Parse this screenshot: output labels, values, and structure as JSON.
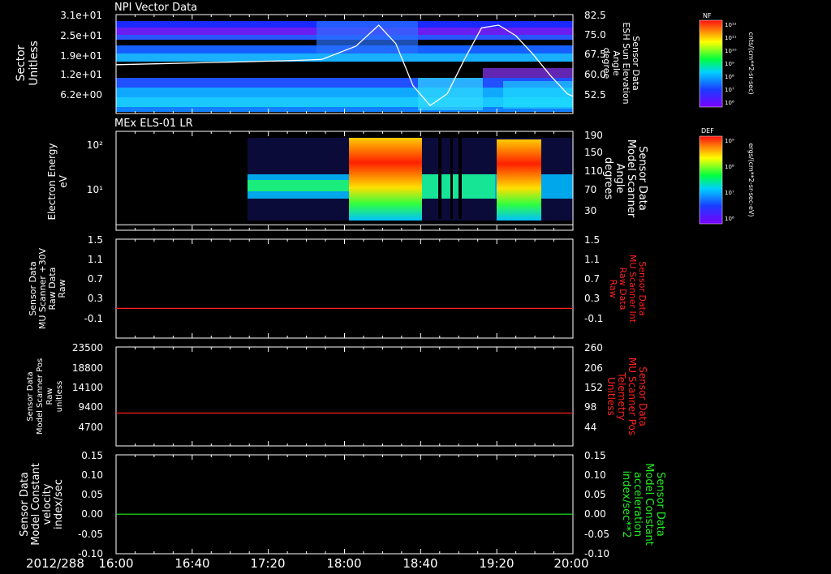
{
  "date_label": "2012/288",
  "time_axis": [
    "16:00",
    "16:40",
    "17:20",
    "18:00",
    "18:40",
    "19:20",
    "20:00"
  ],
  "colors": {
    "frame": "#ffffff",
    "red_trace": "#ff2020",
    "green_trace": "#22ee22",
    "white_trace": "#ffffff"
  },
  "chart_data": [
    {
      "id": "panel1",
      "type": "heatmap",
      "title": "NPI Vector Data",
      "ylabel_lines": [
        "Sector",
        "Unitless"
      ],
      "y_ticks": [
        "3.1e+01",
        "2.5e+01",
        "1.9e+01",
        "1.2e+01",
        "6.2e+00"
      ],
      "ylim": [
        0,
        31
      ],
      "y2label_lines": [
        "Sensor Data",
        "ESH Sun Elevation",
        "Angle",
        "degree"
      ],
      "y2_ticks": [
        "82.5",
        "75.0",
        "67.5",
        "60.0",
        "52.5"
      ],
      "y2lim": [
        47.5,
        85.0
      ],
      "colorbar": {
        "label": "NF",
        "units": "cnts/(cm**2-sr-sec)",
        "ticks": [
          "10¹²",
          "10¹¹",
          "10¹⁰",
          "10⁹",
          "10⁸",
          "10⁷",
          "10⁶"
        ]
      },
      "line_series": {
        "times": [
          16.0,
          16.5,
          17.0,
          17.5,
          17.8,
          18.1,
          18.3,
          18.45,
          18.6,
          18.75,
          18.9,
          19.05,
          19.2,
          19.35,
          19.5,
          19.65,
          19.8,
          19.95,
          20.0
        ],
        "values": [
          66,
          66.5,
          67,
          67.5,
          68,
          73,
          81,
          74,
          58,
          50.5,
          55,
          68,
          80,
          81,
          77,
          70,
          62,
          55,
          54
        ]
      }
    },
    {
      "id": "panel2",
      "type": "heatmap",
      "title": "MEx ELS-01 LR",
      "ylabel_lines": [
        "Electron Energy",
        "eV"
      ],
      "y_ticks": [
        "10²",
        "10¹"
      ],
      "y2label_lines": [
        "Sensor Data",
        "Model Scanner",
        "Angle",
        "degrees"
      ],
      "y2_ticks": [
        "190",
        "150",
        "110",
        "70",
        "30"
      ],
      "y2lim": [
        10,
        190
      ],
      "colorbar": {
        "label": "DEF",
        "units": "ergs/(cm**2-sr-sec-eV)",
        "ticks": [
          "10⁹",
          "10⁸",
          "10⁷",
          "10⁶"
        ]
      },
      "line_series": {
        "times": [
          16.0,
          20.0
        ],
        "values": [
          20,
          20
        ]
      }
    },
    {
      "id": "panel3",
      "type": "line",
      "ylabel_lines": [
        "Sensor Data",
        "MU Scanner +30V",
        "Raw Data",
        "Raw"
      ],
      "y_ticks": [
        "1.5",
        "1.1",
        "0.7",
        "0.3",
        "-0.1"
      ],
      "ylim": [
        -0.5,
        1.5
      ],
      "y2label_lines": [
        "Sensor Data",
        "MU Scanner Int",
        "Raw Data",
        "Raw"
      ],
      "y2_ticks": [
        "1.5",
        "1.1",
        "0.7",
        "0.3",
        "-0.1"
      ],
      "series": [
        {
          "times": [
            16.0,
            20.0
          ],
          "values": [
            0.1,
            0.1
          ]
        }
      ]
    },
    {
      "id": "panel4",
      "type": "line",
      "ylabel_lines": [
        "Sensor Data",
        "Model Scanner Pos",
        "Raw",
        "unitless"
      ],
      "y_ticks": [
        "23500",
        "18800",
        "14100",
        "9400",
        "4700"
      ],
      "ylim": [
        0,
        23500
      ],
      "y2label_lines": [
        "Sensor Data",
        "MU Scanner Pos",
        "Telemetry",
        "Unitless"
      ],
      "y2_ticks": [
        "260",
        "206",
        "152",
        "98",
        "44"
      ],
      "series": [
        {
          "times": [
            16.0,
            20.0
          ],
          "values": [
            7800,
            7800
          ]
        }
      ]
    },
    {
      "id": "panel5",
      "type": "line",
      "ylabel_lines": [
        "Sensor Data",
        "Model Constant",
        "velocity",
        "index/sec"
      ],
      "y_ticks": [
        "0.15",
        "0.10",
        "0.05",
        "0.00",
        "-0.05",
        "-0.10"
      ],
      "ylim": [
        -0.1,
        0.15
      ],
      "y2label_lines": [
        "Sensor Data",
        "Model Constant",
        "acceleration",
        "index/sec**2"
      ],
      "y2_ticks": [
        "0.15",
        "0.10",
        "0.05",
        "0.00",
        "-0.05",
        "-0.10"
      ],
      "series": [
        {
          "times": [
            16.0,
            20.0
          ],
          "values": [
            0.0,
            0.0
          ]
        }
      ]
    }
  ]
}
